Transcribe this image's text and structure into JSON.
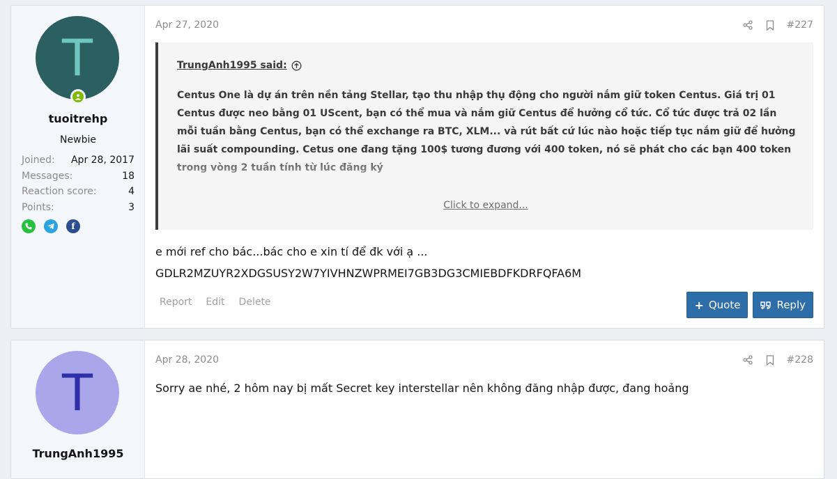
{
  "posts": [
    {
      "avatar_letter": "T",
      "username": "tuoitrehp",
      "user_title": "Newbie",
      "stats": [
        {
          "label": "Joined:",
          "value": "Apr 28, 2017"
        },
        {
          "label": "Messages:",
          "value": "18"
        },
        {
          "label": "Reaction score:",
          "value": "4"
        },
        {
          "label": "Points:",
          "value": "3"
        }
      ],
      "social_icons": [
        "phone-icon",
        "telegram-icon",
        "facebook-icon"
      ],
      "date": "Apr 27, 2020",
      "number": "#227",
      "quote": {
        "author": "TrungAnh1995 said:",
        "text": "Centus One là dự án trên nền tảng Stellar, tạo thu nhập thụ động cho người nắm giữ token Centus. Giá trị 01 Centus được neo bằng 01 UScent, bạn có thể mua và nắm giữ Centus để hưởng cổ tức. Cổ tức được trả 02 lần mỗi tuần bằng Centus, bạn có thể exchange ra BTC, XLM... và rút bất cứ lúc nào hoặc tiếp tục nắm giữ để hưởng lãi suất compounding. Cetus one đang tặng 100$ tương đương với 400 token, nó sẽ phát cho các bạn 400 token trong vòng 2 tuần tính từ lúc đăng ký",
        "expand": "Click to expand..."
      },
      "body_line1": "e mới ref cho bác...bác cho e xin tí để đk với ạ ...",
      "body_line2": "GDLR2MZUYR2XDGSUSY2W7YIVHNZWPRMEI7GB3DG3CMIEBDFKDRFQFA6M",
      "actions": {
        "report": "Report",
        "edit": "Edit",
        "delete": "Delete"
      },
      "buttons": {
        "quote": "Quote",
        "reply": "Reply"
      }
    },
    {
      "avatar_letter": "T",
      "username": "TrungAnh1995",
      "date": "Apr 28, 2020",
      "number": "#228",
      "body": "Sorry ae nhé, 2 hôm nay bị mất Secret key interstellar nên không đăng nhập được, đang hoảng"
    }
  ],
  "colors": {
    "avatar1_bg": "#2c5f5f",
    "avatar1_fg": "#6fc7c2",
    "avatar2_bg": "#a9a7ea",
    "avatar2_fg": "#2f2fa8",
    "button": "#2d6da8",
    "online": "#7fb900"
  }
}
